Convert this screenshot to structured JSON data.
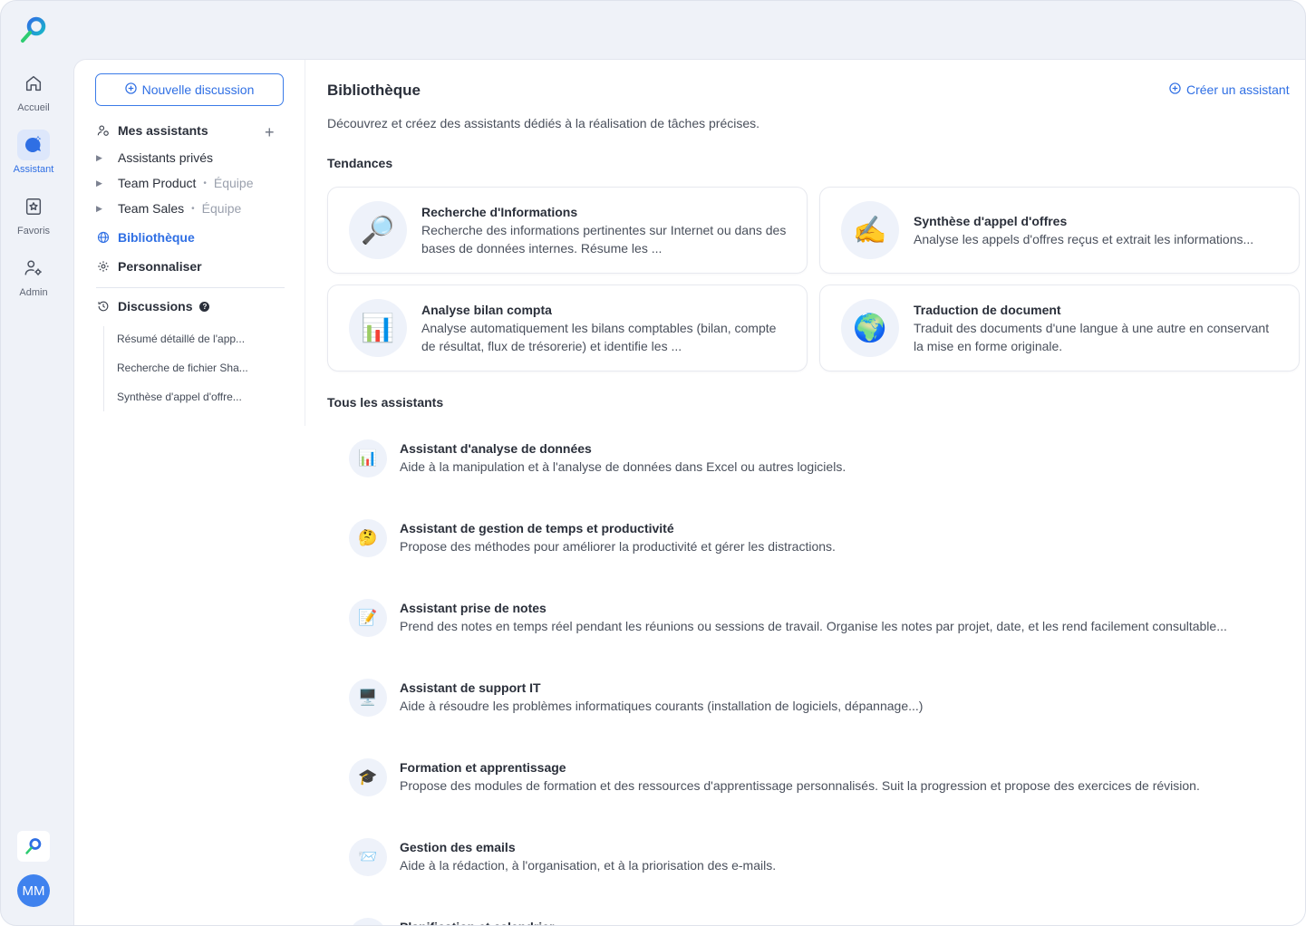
{
  "rail": {
    "items": [
      {
        "label": "Accueil",
        "icon": "home-icon"
      },
      {
        "label": "Assistant",
        "icon": "assistant-icon",
        "active": true
      },
      {
        "label": "Favoris",
        "icon": "favorites-icon"
      },
      {
        "label": "Admin",
        "icon": "admin-icon"
      }
    ],
    "avatar": "MM"
  },
  "sidebar": {
    "new_discussion": "Nouvelle discussion",
    "my_assistants": "Mes assistants",
    "groups": [
      {
        "label": "Assistants privés",
        "tag": ""
      },
      {
        "label": "Team Product",
        "tag": "Équipe"
      },
      {
        "label": "Team Sales",
        "tag": "Équipe"
      }
    ],
    "library": "Bibliothèque",
    "customize": "Personnaliser",
    "discussions": "Discussions",
    "history": [
      "Résumé détaillé de l'app...",
      "Recherche de fichier Sha...",
      "Synthèse d'appel d'offre..."
    ]
  },
  "main": {
    "title": "Bibliothèque",
    "create": "Créer un assistant",
    "subtitle": "Découvrez et créez des assistants dédiés à la réalisation de tâches précises.",
    "trending_title": "Tendances",
    "trending": [
      {
        "emoji": "🔎",
        "name": "Recherche d'Informations",
        "desc": "Recherche des informations pertinentes sur Internet ou dans des bases de données internes. Résume les ..."
      },
      {
        "emoji": "✍️",
        "name": "Synthèse d'appel d'offres",
        "desc": "Analyse les appels d'offres reçus et extrait les informations..."
      },
      {
        "emoji": "📊",
        "name": "Analyse bilan compta",
        "desc": "Analyse automatiquement les bilans comptables (bilan, compte de résultat, flux de trésorerie) et identifie les ..."
      },
      {
        "emoji": "🌍",
        "name": "Traduction de document",
        "desc": "Traduit des documents d'une langue à une autre en conservant la mise en forme originale."
      }
    ],
    "all_title": "Tous les assistants",
    "all": [
      {
        "emoji": "📊",
        "name": "Assistant d'analyse de données",
        "desc": "Aide à la manipulation et à l'analyse de données dans Excel ou autres logiciels."
      },
      {
        "emoji": "🤔",
        "name": "Assistant de gestion de temps et productivité",
        "desc": "Propose des méthodes pour améliorer la productivité et gérer les distractions."
      },
      {
        "emoji": "📝",
        "name": "Assistant prise de notes",
        "desc": "Prend des notes en temps réel pendant les réunions ou sessions de travail. Organise les notes par projet, date, et les rend facilement consultable..."
      },
      {
        "emoji": "🖥️",
        "name": "Assistant de support IT",
        "desc": "Aide à résoudre les problèmes informatiques courants (installation de logiciels, dépannage...)"
      },
      {
        "emoji": "🎓",
        "name": "Formation et apprentissage",
        "desc": "Propose des modules de formation et des ressources d'apprentissage personnalisés. Suit la progression et propose des exercices de révision."
      },
      {
        "emoji": "📨",
        "name": "Gestion des emails",
        "desc": "Aide à la rédaction, à l'organisation, et à la priorisation des e-mails."
      },
      {
        "emoji": "📅",
        "name": "Planification et calendrier",
        "desc": ""
      }
    ]
  },
  "colors": {
    "accent": "#2f6fe4",
    "rail_bg": "#eff2f8",
    "avatar": "#3f82ee"
  }
}
